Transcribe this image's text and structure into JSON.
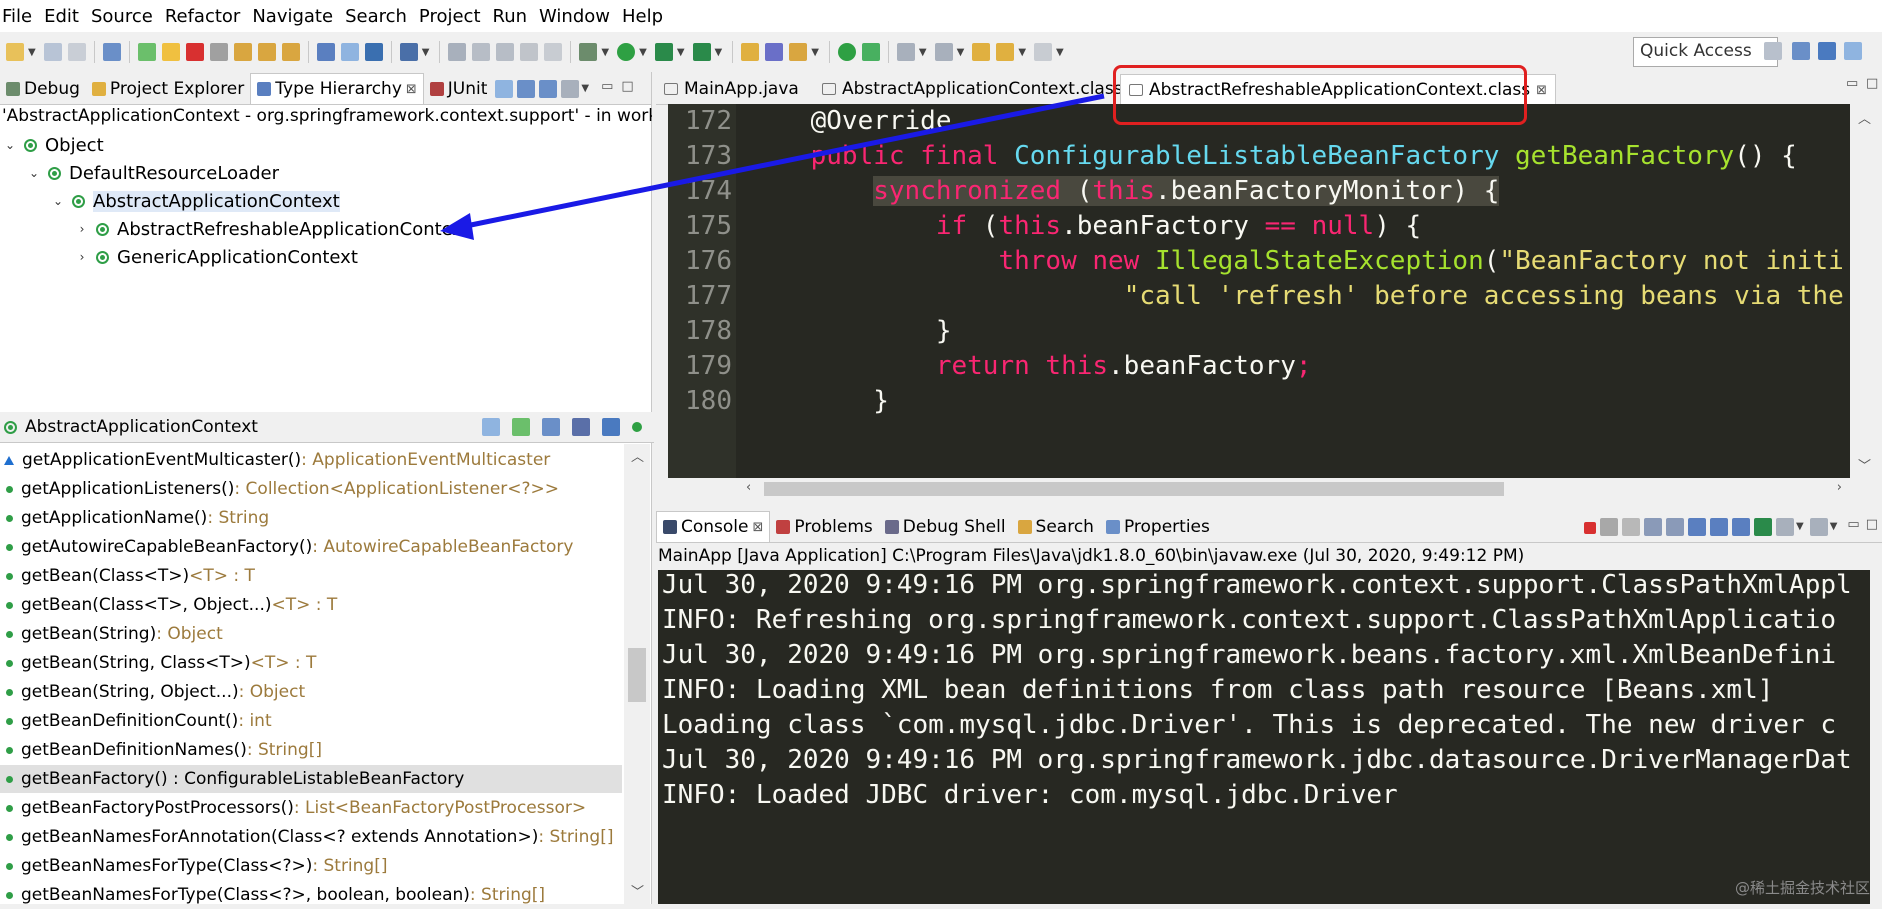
{
  "menu": [
    "File",
    "Edit",
    "Source",
    "Refactor",
    "Navigate",
    "Search",
    "Project",
    "Run",
    "Window",
    "Help"
  ],
  "toolbar": {
    "quick_access": "Quick Access"
  },
  "left_tabs": [
    {
      "label": "Debug"
    },
    {
      "label": "Project Explorer"
    },
    {
      "label": "Type Hierarchy",
      "close": "⊠"
    },
    {
      "label": "JUnit"
    }
  ],
  "hierarchy": {
    "path": "'AbstractApplicationContext - org.springframework.context.support' - in working s",
    "nodes": [
      {
        "label": "Object",
        "expander": "⌄"
      },
      {
        "label": "DefaultResourceLoader",
        "expander": "⌄"
      },
      {
        "label": "AbstractApplicationContext",
        "expander": "⌄"
      },
      {
        "label": "AbstractRefreshableApplicationContext",
        "expander": "›"
      },
      {
        "label": "GenericApplicationContext",
        "expander": "›"
      }
    ]
  },
  "members": {
    "header": "AbstractApplicationContext",
    "items": [
      {
        "name": "getApplicationEventMulticaster()",
        "type": " : ApplicationEventMulticaster"
      },
      {
        "name": "getApplicationListeners()",
        "type": " : Collection<ApplicationListener<?>>"
      },
      {
        "name": "getApplicationName()",
        "type": " : String"
      },
      {
        "name": "getAutowireCapableBeanFactory()",
        "type": " : AutowireCapableBeanFactory"
      },
      {
        "name": "getBean(Class<T>)",
        "type": " <T> : T"
      },
      {
        "name": "getBean(Class<T>, Object...)",
        "type": " <T> : T"
      },
      {
        "name": "getBean(String)",
        "type": " : Object"
      },
      {
        "name": "getBean(String, Class<T>)",
        "type": " <T> : T"
      },
      {
        "name": "getBean(String, Object...)",
        "type": " : Object"
      },
      {
        "name": "getBeanDefinitionCount()",
        "type": " : int"
      },
      {
        "name": "getBeanDefinitionNames()",
        "type": " : String[]"
      },
      {
        "name": "getBeanFactory() : ConfigurableListableBeanFactory",
        "type": ""
      },
      {
        "name": "getBeanFactoryPostProcessors()",
        "type": " : List<BeanFactoryPostProcessor>"
      },
      {
        "name": "getBeanNamesForAnnotation(Class<? extends Annotation>)",
        "type": " : String[]"
      },
      {
        "name": "getBeanNamesForType(Class<?>)",
        "type": " : String[]"
      },
      {
        "name": "getBeanNamesForType(Class<?>, boolean, boolean)",
        "type": " : String[]"
      }
    ]
  },
  "editor_tabs": [
    {
      "label": "MainApp.java"
    },
    {
      "label": "AbstractApplicationContext.class"
    },
    {
      "label": "AbstractRefreshableApplicationContext.class",
      "close": "⊠"
    }
  ],
  "code": {
    "line_numbers": [
      "172",
      "173",
      "174",
      "175",
      "176",
      "177",
      "178",
      "179",
      "180"
    ],
    "lines": [
      [
        {
          "t": "    @Override",
          "c": "an"
        }
      ],
      [
        {
          "t": "    ",
          "c": ""
        },
        {
          "t": "public final ",
          "c": "kw"
        },
        {
          "t": "ConfigurableListableBeanFactory ",
          "c": "ty"
        },
        {
          "t": "getBeanFactory",
          "c": "fn"
        },
        {
          "t": "() {",
          "c": ""
        }
      ],
      [
        {
          "t": "        ",
          "c": ""
        },
        {
          "t": "synchronized",
          "c": "kw"
        },
        {
          "t": " (",
          "c": ""
        },
        {
          "t": "this",
          "c": "kw"
        },
        {
          "t": ".beanFactoryMonitor) {",
          "c": ""
        }
      ],
      [
        {
          "t": "            ",
          "c": ""
        },
        {
          "t": "if",
          "c": "kw"
        },
        {
          "t": " (",
          "c": ""
        },
        {
          "t": "this",
          "c": "kw"
        },
        {
          "t": ".beanFactory ",
          "c": ""
        },
        {
          "t": "==",
          "c": "kw"
        },
        {
          "t": " ",
          "c": ""
        },
        {
          "t": "null",
          "c": "kw"
        },
        {
          "t": ") {",
          "c": ""
        }
      ],
      [
        {
          "t": "                ",
          "c": ""
        },
        {
          "t": "throw new ",
          "c": "kw"
        },
        {
          "t": "IllegalStateException",
          "c": "fn"
        },
        {
          "t": "(",
          "c": ""
        },
        {
          "t": "\"BeanFactory not initi",
          "c": "st"
        }
      ],
      [
        {
          "t": "                        ",
          "c": ""
        },
        {
          "t": "\"call 'refresh' before accessing beans via the",
          "c": "st"
        }
      ],
      [
        {
          "t": "            }",
          "c": ""
        }
      ],
      [
        {
          "t": "            ",
          "c": ""
        },
        {
          "t": "return this",
          "c": "kw"
        },
        {
          "t": ".beanFactory",
          "c": ""
        },
        {
          "t": ";",
          "c": "kw"
        }
      ],
      [
        {
          "t": "        }",
          "c": ""
        }
      ]
    ]
  },
  "console_tabs": [
    {
      "label": "Console",
      "close": "⊠"
    },
    {
      "label": "Problems"
    },
    {
      "label": "Debug Shell"
    },
    {
      "label": "Search"
    },
    {
      "label": "Properties"
    }
  ],
  "console": {
    "header": "MainApp [Java Application] C:\\Program Files\\Java\\jdk1.8.0_60\\bin\\javaw.exe (Jul 30, 2020, 9:49:12 PM)",
    "lines": [
      "Jul 30, 2020 9:49:16 PM org.springframework.context.support.ClassPathXmlAppl",
      "INFO: Refreshing org.springframework.context.support.ClassPathXmlApplicatio",
      "Jul 30, 2020 9:49:16 PM org.springframework.beans.factory.xml.XmlBeanDefini",
      "INFO: Loading XML bean definitions from class path resource [Beans.xml]",
      "Loading class `com.mysql.jdbc.Driver'. This is deprecated. The new driver c",
      "Jul 30, 2020 9:49:16 PM org.springframework.jdbc.datasource.DriverManagerDat",
      "INFO: Loaded JDBC driver: com.mysql.jdbc.Driver"
    ]
  },
  "watermark": "@稀土掘金技术社区",
  "colors": {
    "annotation_box": "#e02020",
    "arrow": "#1a1ae6",
    "editor_bg": "#272822"
  }
}
